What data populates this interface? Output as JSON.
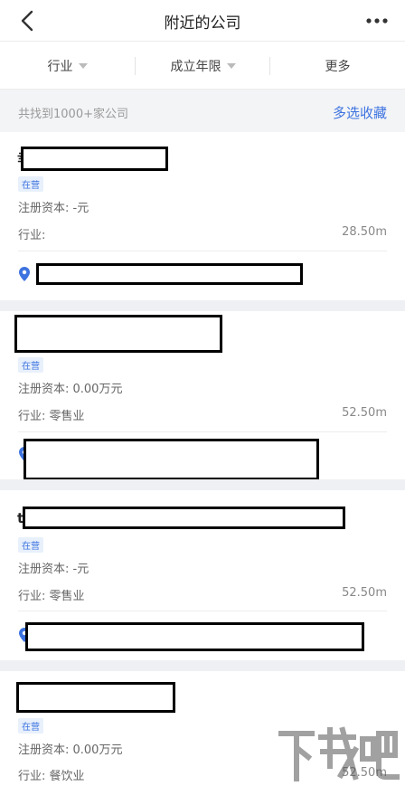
{
  "header": {
    "title": "附近的公司",
    "back_icon": "chevron-left-icon",
    "menu_icon": "more-dots-icon"
  },
  "filters": [
    {
      "label": "行业",
      "has_caret": true
    },
    {
      "label": "成立年限",
      "has_caret": true
    },
    {
      "label": "更多",
      "has_caret": false
    }
  ],
  "summary": {
    "count_text": "共找到1000+家公司",
    "multi_select_label": "多选收藏"
  },
  "colors": {
    "accent": "#3d73e0",
    "badge_bg": "#e8f0fc",
    "section_bg": "#f3f4f6"
  },
  "companies": [
    {
      "name_fragment": "幸",
      "status": "在营",
      "capital": "注册资本: -元",
      "industry": "行业:",
      "distance": "28.50m",
      "address_icon": "location-pin-icon"
    },
    {
      "name_fragment": "",
      "status": "在营",
      "capital": "注册资本: 0.00万元",
      "industry": "行业: 零售业",
      "distance": "52.50m",
      "address_icon": "location-pin-icon"
    },
    {
      "name_fragment": "t",
      "status": "在营",
      "capital": "注册资本: -元",
      "industry": "行业: 零售业",
      "distance": "52.50m",
      "address_icon": "location-pin-icon"
    },
    {
      "name_fragment": "",
      "status": "在营",
      "capital": "注册资本: 0.00万元",
      "industry": "行业: 餐饮业",
      "distance": "52.50m",
      "address_icon": "location-pin-icon"
    }
  ],
  "watermark": {
    "text": "下载吧",
    "icon": "watermark-logo-icon"
  }
}
